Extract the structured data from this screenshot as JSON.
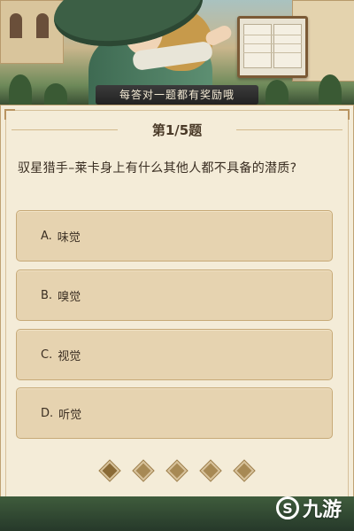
{
  "banner": {
    "ribbon_text": "每答对一题都有奖励哦"
  },
  "quiz": {
    "counter": "第1/5题",
    "question": "驭星猎手–莱卡身上有什么其他人都不具备的潜质?",
    "options": [
      {
        "key": "A.",
        "label": "味觉"
      },
      {
        "key": "B.",
        "label": "嗅觉"
      },
      {
        "key": "C.",
        "label": "视觉"
      },
      {
        "key": "D.",
        "label": "听觉"
      }
    ],
    "progress": {
      "current": 1,
      "total": 5
    }
  },
  "watermark": {
    "logo_glyph": "S",
    "text": "九游"
  },
  "colors": {
    "panel_bg": "#f4ecd8",
    "option_bg": "#e6d3b0",
    "text": "#3a2e22"
  }
}
